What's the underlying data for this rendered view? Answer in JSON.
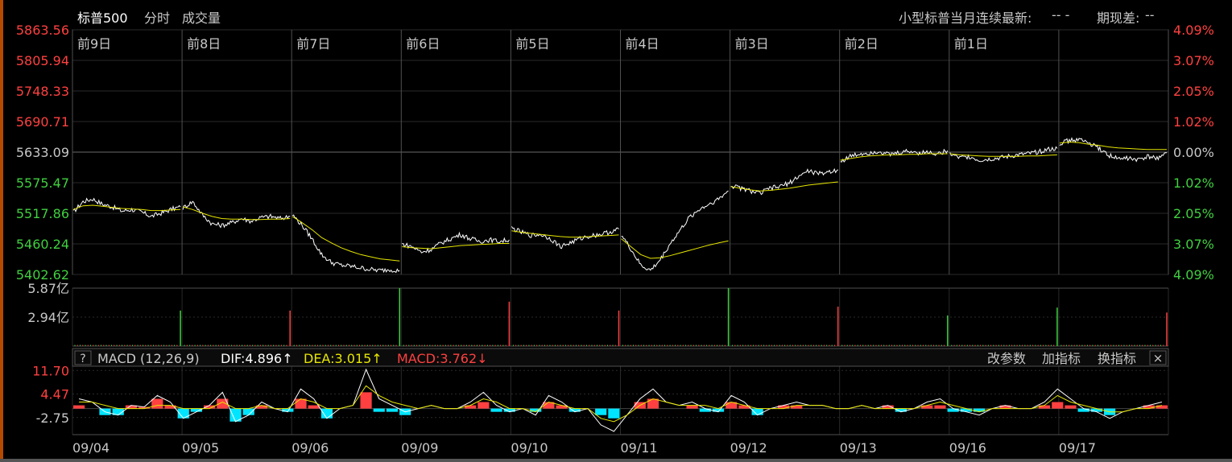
{
  "header": {
    "title": "标普500",
    "tab_time": "分时",
    "tab_volume": "成交量",
    "future_label": "小型标普当月连续最新:",
    "future_value": "-- -",
    "basis_label": "期现差:",
    "basis_value": "--"
  },
  "macd_bar": {
    "help": "?",
    "name": "MACD (12,26,9)",
    "dif": "DIF:4.896",
    "dea": "DEA:3.015",
    "macd": "MACD:3.762",
    "btn_params": "改参数",
    "btn_add": "加指标",
    "btn_switch": "换指标",
    "btn_close": "×"
  },
  "colors": {
    "price": "#ffffff",
    "average": "#e6e600",
    "up": "#ff4040",
    "down": "#40d040",
    "grid": "#2a2a2a",
    "grid_bright": "#505050",
    "cyan": "#00e5ff",
    "text": "#c8c8c8"
  },
  "chart_data": [
    {
      "type": "line",
      "name": "price",
      "day_labels": [
        "前9日",
        "前8日",
        "前7日",
        "前6日",
        "前5日",
        "前4日",
        "前3日",
        "前2日",
        "前1日"
      ],
      "price_ticks": [
        "5863.56",
        "5805.94",
        "5748.33",
        "5690.71",
        "5633.09",
        "5575.47",
        "5517.86",
        "5460.24",
        "5402.62"
      ],
      "pct_ticks": [
        "4.09%",
        "3.07%",
        "2.05%",
        "1.02%",
        "0.00%",
        "1.02%",
        "2.05%",
        "3.07%",
        "4.09%"
      ],
      "ylim": [
        5402.62,
        5863.56
      ],
      "reference": 5633.09,
      "days": [
        {
          "date": "09/04",
          "price": [
            5520,
            5540,
            5545,
            5535,
            5530,
            5522,
            5525,
            5520,
            5512,
            5518,
            5525,
            5530
          ],
          "avg": [
            5525,
            5532,
            5533,
            5531,
            5529,
            5527,
            5526,
            5525,
            5523,
            5523,
            5524,
            5525
          ]
        },
        {
          "date": "09/05",
          "price": [
            5528,
            5540,
            5515,
            5498,
            5495,
            5500,
            5508,
            5503,
            5510,
            5512,
            5508,
            5512
          ],
          "avg": [
            5530,
            5525,
            5518,
            5512,
            5508,
            5507,
            5507,
            5506,
            5506,
            5507,
            5507,
            5508
          ]
        },
        {
          "date": "09/06",
          "price": [
            5515,
            5495,
            5470,
            5440,
            5425,
            5420,
            5418,
            5415,
            5412,
            5410,
            5412,
            5410
          ],
          "avg": [
            5512,
            5500,
            5487,
            5472,
            5462,
            5453,
            5446,
            5440,
            5436,
            5432,
            5430,
            5428
          ]
        },
        {
          "date": "09/09",
          "price": [
            5460,
            5455,
            5445,
            5450,
            5462,
            5470,
            5478,
            5470,
            5465,
            5468,
            5465,
            5468
          ],
          "avg": [
            5455,
            5453,
            5452,
            5451,
            5453,
            5455,
            5457,
            5458,
            5459,
            5460,
            5461,
            5461
          ]
        },
        {
          "date": "09/10",
          "price": [
            5490,
            5482,
            5476,
            5478,
            5470,
            5455,
            5462,
            5470,
            5475,
            5478,
            5482,
            5488
          ],
          "avg": [
            5485,
            5482,
            5480,
            5478,
            5476,
            5474,
            5473,
            5473,
            5474,
            5475,
            5476,
            5477
          ]
        },
        {
          "date": "09/11",
          "price": [
            5478,
            5450,
            5420,
            5410,
            5430,
            5460,
            5485,
            5510,
            5525,
            5535,
            5545,
            5560
          ],
          "avg": [
            5470,
            5455,
            5440,
            5433,
            5434,
            5438,
            5443,
            5448,
            5453,
            5458,
            5462,
            5466
          ]
        },
        {
          "date": "09/12",
          "price": [
            5570,
            5565,
            5560,
            5555,
            5565,
            5568,
            5575,
            5588,
            5598,
            5592,
            5596,
            5600
          ],
          "avg": [
            5568,
            5565,
            5562,
            5560,
            5561,
            5563,
            5565,
            5568,
            5571,
            5573,
            5575,
            5577
          ]
        },
        {
          "date": "09/13",
          "price": [
            5615,
            5625,
            5630,
            5632,
            5635,
            5628,
            5632,
            5635,
            5632,
            5633,
            5630,
            5636
          ],
          "avg": [
            5618,
            5621,
            5624,
            5626,
            5627,
            5628,
            5628,
            5629,
            5629,
            5630,
            5630,
            5630
          ]
        },
        {
          "date": "09/16",
          "price": [
            5630,
            5622,
            5625,
            5618,
            5620,
            5622,
            5625,
            5628,
            5630,
            5633,
            5638,
            5640
          ],
          "avg": [
            5630,
            5628,
            5627,
            5626,
            5625,
            5625,
            5625,
            5625,
            5626,
            5626,
            5627,
            5628
          ]
        },
        {
          "date": "09/17",
          "price": [
            5650,
            5655,
            5657,
            5650,
            5640,
            5628,
            5620,
            5622,
            5618,
            5624,
            5622,
            5632
          ],
          "avg": [
            5650,
            5652,
            5651,
            5648,
            5646,
            5643,
            5641,
            5640,
            5639,
            5638,
            5638,
            5638
          ]
        }
      ]
    },
    {
      "type": "bar",
      "name": "volume",
      "ticks": [
        "5.87亿",
        "2.94亿"
      ],
      "ylim": [
        0,
        5.87
      ],
      "unit": "亿",
      "spikes": [
        {
          "day": 0,
          "value": 3.6,
          "dir": "down"
        },
        {
          "day": 1,
          "value": 3.6,
          "dir": "up"
        },
        {
          "day": 2,
          "value": 5.87,
          "dir": "down"
        },
        {
          "day": 3,
          "value": 4.5,
          "dir": "up"
        },
        {
          "day": 4,
          "value": 3.6,
          "dir": "up"
        },
        {
          "day": 5,
          "value": 5.87,
          "dir": "down"
        },
        {
          "day": 6,
          "value": 4.0,
          "dir": "up"
        },
        {
          "day": 7,
          "value": 3.1,
          "dir": "down"
        },
        {
          "day": 8,
          "value": 3.9,
          "dir": "down"
        },
        {
          "day": 9,
          "value": 3.4,
          "dir": "up"
        }
      ]
    },
    {
      "type": "line",
      "name": "MACD",
      "ticks": [
        "11.70",
        "4.47",
        "-2.75"
      ],
      "ylim": [
        -8,
        13
      ],
      "x_labels": [
        "09/04",
        "09/05",
        "09/06",
        "09/09",
        "09/10",
        "09/11",
        "09/12",
        "09/13",
        "09/16",
        "09/17"
      ],
      "dif": [
        3,
        2,
        -1,
        -2,
        1,
        0.5,
        4,
        2,
        -3,
        -1,
        1,
        5,
        -4,
        -2,
        2,
        0,
        -1,
        6,
        3,
        -3,
        0,
        1,
        12,
        3,
        1,
        -1,
        0,
        1,
        0,
        0,
        2,
        5,
        1,
        -1,
        0,
        -2,
        4,
        2,
        -1,
        0,
        -5,
        -7,
        -2,
        3,
        6,
        2,
        1,
        2,
        0,
        -1,
        4,
        2,
        -2,
        0,
        1,
        2,
        1,
        1,
        0,
        0,
        1,
        0,
        1,
        -1,
        0,
        2,
        3,
        0,
        -1,
        -2,
        0,
        1,
        0,
        0,
        2,
        6,
        3,
        0,
        -1,
        -3,
        -1,
        0,
        1,
        2
      ],
      "dea": [
        2,
        2,
        1,
        0,
        0,
        0,
        1,
        1,
        0,
        0,
        0,
        2,
        0,
        0,
        1,
        0,
        0,
        3,
        2,
        0,
        0,
        1,
        7,
        4,
        2,
        1,
        0,
        1,
        0,
        0,
        1,
        3,
        2,
        0,
        0,
        -1,
        2,
        1,
        0,
        0,
        -3,
        -4,
        -2,
        1,
        3,
        2,
        1,
        1,
        1,
        0,
        2,
        1,
        0,
        0,
        0,
        1,
        1,
        1,
        0,
        0,
        1,
        0,
        0,
        0,
        0,
        1,
        2,
        1,
        0,
        -1,
        0,
        0,
        0,
        0,
        1,
        4,
        2,
        1,
        0,
        -1,
        -1,
        0,
        0,
        1
      ],
      "hist": [
        1,
        0,
        -2,
        -2,
        1,
        0.5,
        3,
        1,
        -3,
        -1,
        1,
        3,
        -4,
        -2,
        1,
        0,
        -1,
        3,
        1,
        -3,
        0,
        0,
        5,
        -1,
        -1,
        -2,
        0,
        0,
        0,
        0,
        1,
        2,
        -1,
        -1,
        0,
        -1,
        2,
        1,
        -1,
        0,
        -2,
        -3,
        0,
        2,
        3,
        0,
        0,
        1,
        -1,
        -1,
        2,
        1,
        -2,
        0,
        1,
        1,
        0,
        0,
        0,
        0,
        0,
        0,
        1,
        -1,
        0,
        1,
        1,
        -1,
        -1,
        -1,
        0,
        1,
        0,
        0,
        1,
        2,
        1,
        -1,
        -1,
        -2,
        0,
        0,
        1,
        1
      ]
    }
  ]
}
